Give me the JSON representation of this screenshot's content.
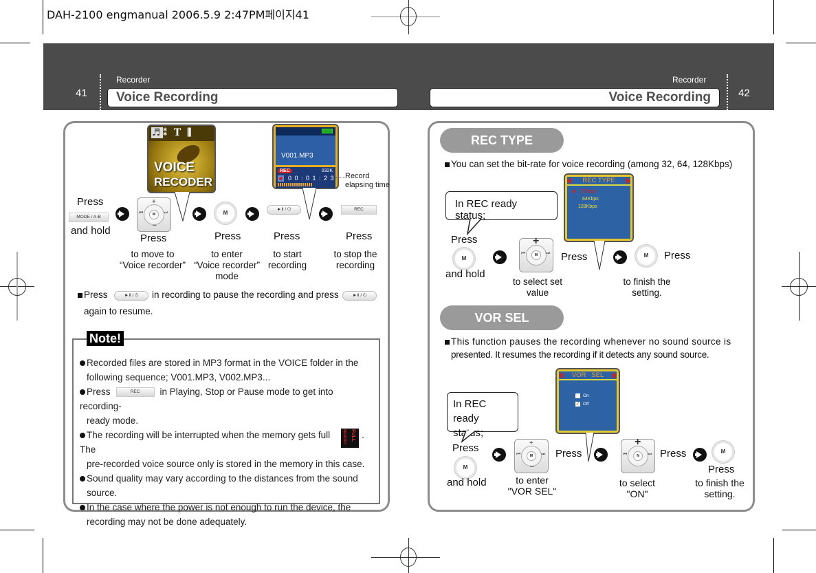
{
  "print_slug": "DAH-2100 engmanual  2006.5.9 2:47PM페이지41",
  "left_page": {
    "page_number": "41",
    "section": "Recorder",
    "title": "Voice Recording",
    "steps": [
      {
        "press": "Press",
        "button": "MODE / A-B",
        "after": "and hold",
        "desc": ""
      },
      {
        "press": "Press",
        "button": "dpad",
        "desc_lines": [
          "to move to",
          "“Voice recorder”"
        ]
      },
      {
        "press": "Press",
        "button": "M",
        "desc_lines": [
          "to enter",
          "“Voice recorder”",
          "mode"
        ]
      },
      {
        "press": "Press",
        "button": "►Ⅱ / ⏻",
        "desc_lines": [
          "to start",
          "recording"
        ]
      },
      {
        "press": "Press",
        "button": "REC",
        "desc_lines": [
          "to stop the",
          "recording"
        ]
      }
    ],
    "voice_screen": {
      "icons": [
        "mic-icon",
        "network-icon",
        "text-icon",
        "tools-icon"
      ],
      "line1": "VOICE",
      "line2": "RECODER"
    },
    "rec_screen": {
      "filename": "V001.MP3",
      "rec_badge": "REC",
      "bitrate": "032K",
      "time": "0 0 : 0 1 : 2 3"
    },
    "record_label": [
      "Record",
      "elapsing time"
    ],
    "pause_note": {
      "press": "Press",
      "button": "►Ⅱ / ⏻",
      "middle": "in recording to pause the recording and press",
      "end": "again to resume."
    },
    "note": {
      "label": "Note!",
      "items": [
        {
          "lines": [
            "Recorded files are stored in MP3 format in the VOICE folder in the",
            "following sequence; V001.MP3, V002.MP3..."
          ]
        },
        {
          "pre": "Press",
          "button": "REC",
          "post": "in Playing, Stop or Pause mode to get into recording-",
          "line2": "ready mode."
        },
        {
          "pre": "The recording will be interrupted when the memory gets full",
          "icon_text": [
            "MEMORY",
            "FULL"
          ],
          "post": ". The",
          "line2": "pre-recorded voice source only is stored in the memory in this case."
        },
        {
          "lines": [
            "Sound quality may vary according to the distances from the sound",
            "source."
          ]
        },
        {
          "lines": [
            "In the case where the power is not enough to run the device, the",
            "recording may not be done adequately."
          ]
        }
      ]
    }
  },
  "right_page": {
    "page_number": "42",
    "section": "Recorder",
    "title": "Voice Recording",
    "rec_type": {
      "heading": "REC TYPE",
      "intro": "You can set the bit-rate for voice recording (among 32, 64, 128Kbps)",
      "bubble": "In REC ready status;",
      "screen_title": "REC TYPE",
      "options": [
        "32Kbps",
        "64Kbps",
        "128Kbps"
      ],
      "selected_option": "32Kbps",
      "step1": {
        "press": "Press",
        "button": "M",
        "after": "and hold"
      },
      "step2": {
        "press": "Press",
        "desc_lines": [
          "to select set",
          "value"
        ]
      },
      "step3": {
        "press": "Press",
        "button": "M",
        "desc_lines": [
          "to finish the",
          "setting."
        ]
      }
    },
    "vor_sel": {
      "heading": "VOR SEL",
      "intro_line1": "This function pauses the recording whenever no sound source is",
      "intro_line2": "presented. It resumes the recording if it detects any sound source.",
      "bubble_lines": [
        "In REC ready",
        "status;"
      ],
      "screen_title": "VOR   SEL",
      "options": [
        {
          "label": "On",
          "checked": false
        },
        {
          "label": "Off",
          "checked": true
        }
      ],
      "step1": {
        "press": "Press",
        "button": "M",
        "after": "and hold"
      },
      "step2": {
        "press": "Press",
        "desc_lines": [
          "to enter",
          "\"VOR SEL\""
        ]
      },
      "step3": {
        "press": "Press",
        "desc_lines": [
          "to select",
          "\"ON\""
        ]
      },
      "step4": {
        "press": "Press",
        "button": "M",
        "desc_lines": [
          "to finish the",
          "setting."
        ]
      }
    }
  },
  "colors": {
    "header_band": "#4b4b4b",
    "lcd_blue": "#2d62a4",
    "lcd_frame": "#e6c830",
    "selected_red": "#d02020",
    "option_yellow": "#e8e040"
  }
}
